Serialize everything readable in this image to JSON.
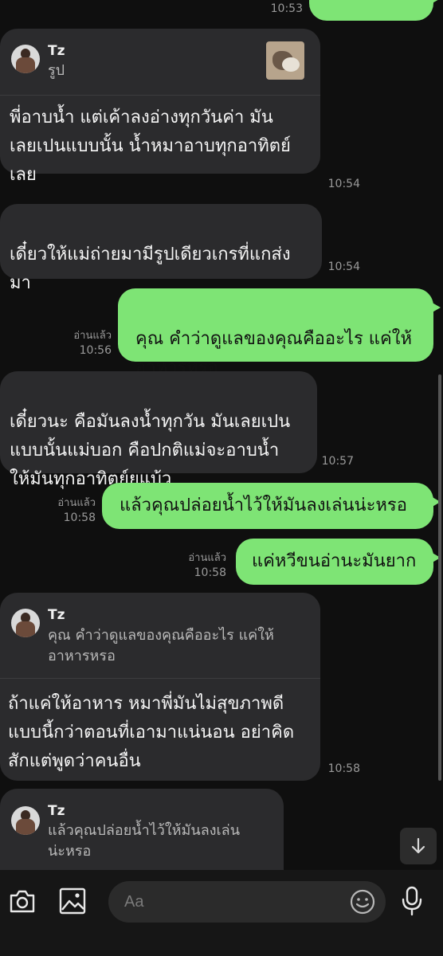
{
  "messages": {
    "top_time": "10:53",
    "m1": {
      "reply_name": "Tz",
      "reply_text": "รูป",
      "text": "พี่อาบน้ำ แต่เค้าลงอ่างทุกวันค่า มัน\nเลยเปนแบบนั้น น้ำหมาอาบทุกอาทิตย์\nเลย",
      "time": "10:54"
    },
    "m2": {
      "text": "เดี๋ยวให้แม่ถ่ายมามีรูปเดียวเกรที่แกส่ง\nมา",
      "time": "10:54"
    },
    "m3": {
      "text": "คุณ คำว่าดูแลของคุณคืออะไร แค่ให้\nอาหารหรอ",
      "read": "อ่านแล้ว",
      "time": "10:56"
    },
    "m4": {
      "text": "เดี๋ยวนะ คือมันลงน้ำทุกวัน มันเลยเปน\nแบบนั้นแม่บอก คือปกติแม่จะอาบน้ำ\nให้มันทุกอาทิตย์ยุแบ้ว",
      "time": "10:57"
    },
    "m5": {
      "text": "แล้วคุณปล่อยน้ำไว้ให้มันลงเล่นน่ะหรอ",
      "read": "อ่านแล้ว",
      "time": "10:58"
    },
    "m6": {
      "text": "แค่หวีขนอ่านะมันยาก",
      "read": "อ่านแล้ว",
      "time": "10:58"
    },
    "m7": {
      "reply_name": "Tz",
      "reply_text": "คุณ คำว่าดูแลของคุณคืออะไร แค่ให้\nอาหารหรอ",
      "text": "ถ้าแค่ให้อาหาร หมาพี่มันไม่สุขภาพดี\nแบบนี้กว่าตอนที่เอามาแน่นอน อย่าคิด\nสักแต่พูดว่าคนอื่น",
      "time": "10:58"
    },
    "m8": {
      "reply_name": "Tz",
      "reply_text": "แล้วคุณปล่อยน้ำไว้ให้มันลงเล่น\nน่ะหรอ"
    }
  },
  "composer": {
    "placeholder": "Aa"
  },
  "icons": {
    "camera": "camera-icon",
    "image": "image-icon",
    "emoji": "emoji-icon",
    "mic": "mic-icon",
    "scroll_down": "arrow-down-icon"
  },
  "colors": {
    "outgoing_bubble": "#7ee475",
    "incoming_bubble": "#2b2b2d",
    "background": "#0f0f0f"
  }
}
